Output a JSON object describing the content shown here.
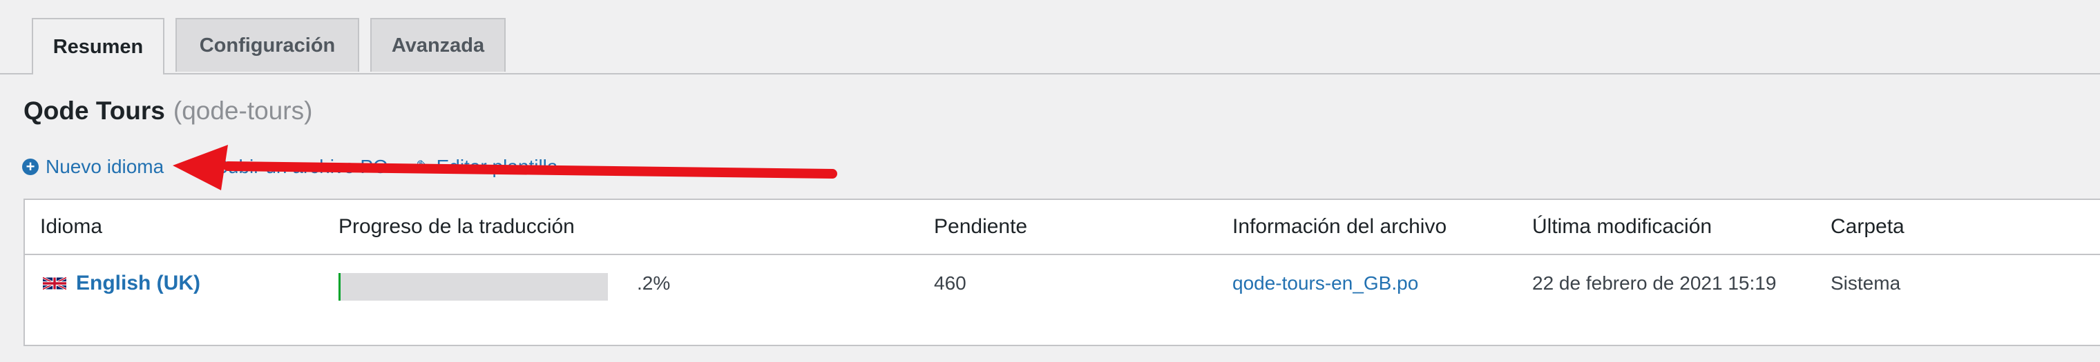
{
  "tabs": [
    {
      "label": "Resumen",
      "active": true
    },
    {
      "label": "Configuración",
      "active": false
    },
    {
      "label": "Avanzada",
      "active": false
    }
  ],
  "title": {
    "name": "Qode Tours",
    "slug": "(qode-tours)"
  },
  "actions": {
    "new_language": "Nuevo idioma",
    "upload_po": "Subir un archivo PO",
    "edit_template": "Editar plantilla"
  },
  "table": {
    "headers": {
      "language": "Idioma",
      "progress": "Progreso de la traducción",
      "pending": "Pendiente",
      "file_info": "Información del archivo",
      "last_modified": "Última modificación",
      "folder": "Carpeta"
    },
    "rows": [
      {
        "language": "English (UK)",
        "flag_icon": "uk-flag-icon",
        "progress_percent": 0.2,
        "progress_label": ".2%",
        "pending": "460",
        "file": "qode-tours-en_GB.po",
        "last_modified": "22 de febrero de 2021 15:19",
        "folder": "Sistema"
      }
    ]
  },
  "colors": {
    "link": "#2271b1",
    "progress_fill": "#00a32a",
    "progress_track": "#dcdcde",
    "annotation_arrow": "#e8141b"
  }
}
